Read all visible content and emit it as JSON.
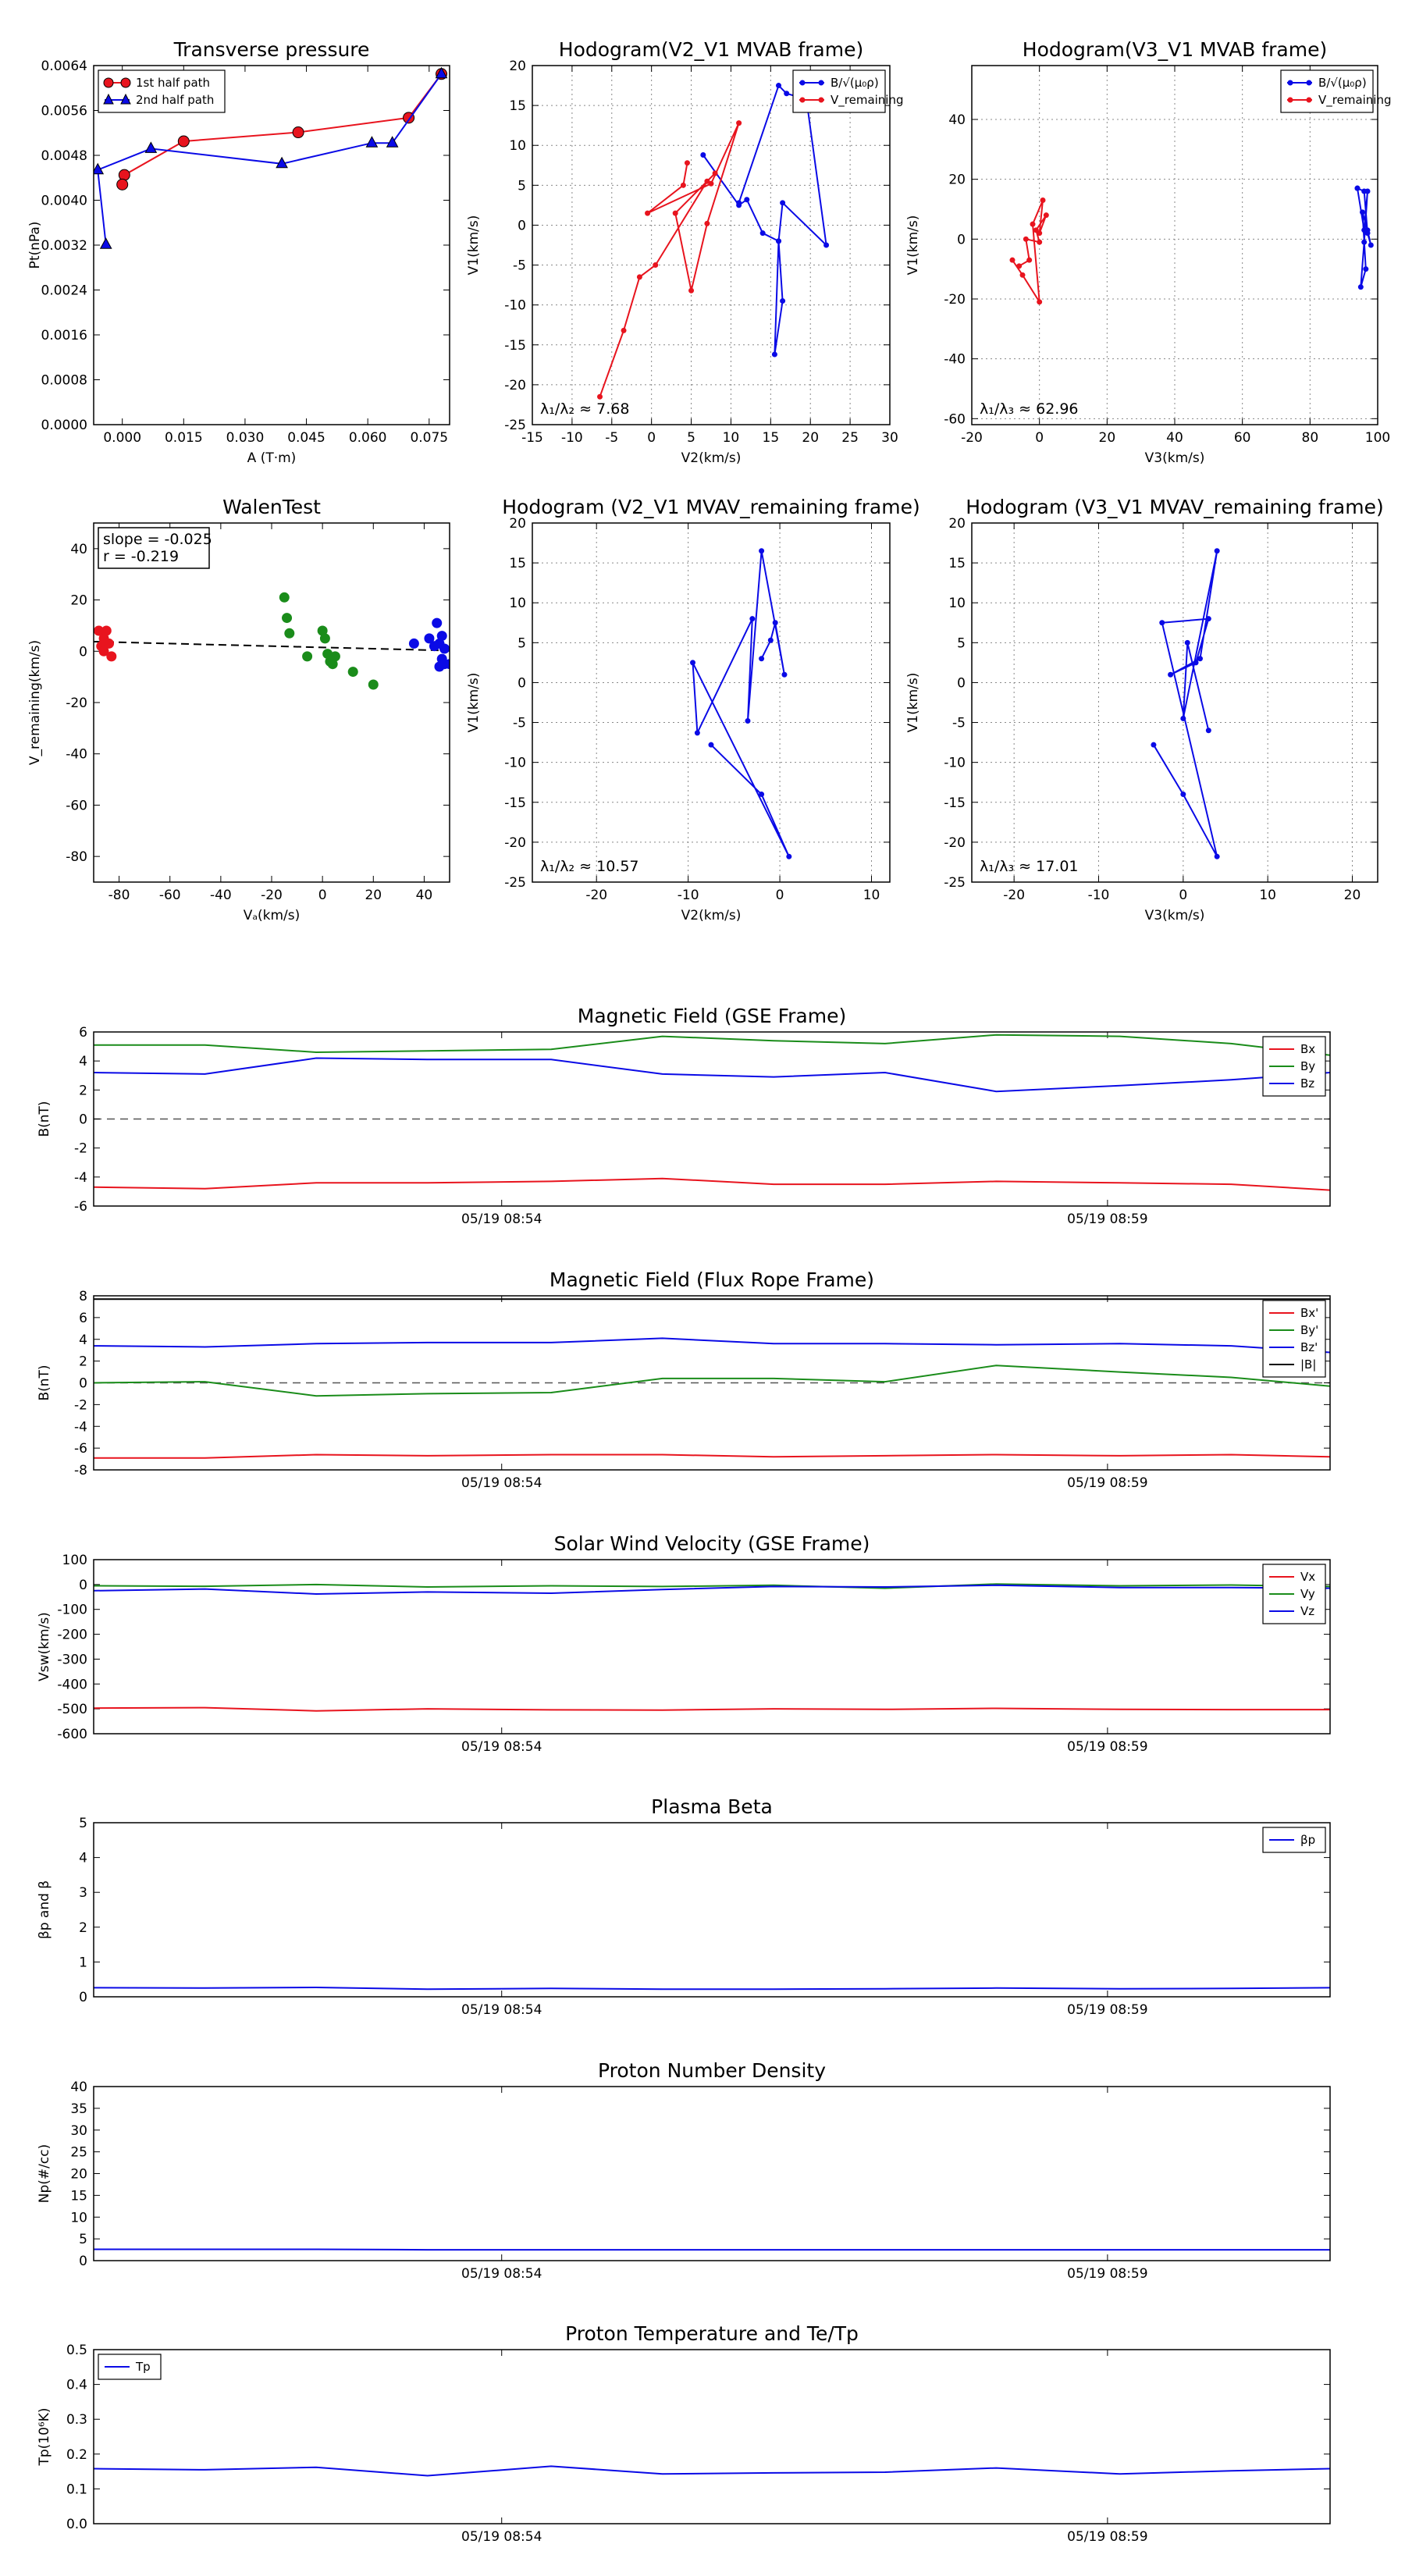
{
  "colors": {
    "red": "#e8141e",
    "green": "#1a8c1a",
    "blue": "#0a0ae6",
    "black": "#000000",
    "grid": "#888888"
  },
  "chart_data": [
    {
      "id": "tp",
      "type": "line",
      "title": "Transverse pressure",
      "xlabel": "A (T·m)",
      "ylabel": "Pt(nPa)",
      "xlim": [
        -0.007,
        0.08
      ],
      "ylim": [
        0,
        0.0064
      ],
      "xticks": [
        0.0,
        0.015,
        0.03,
        0.045,
        0.06,
        0.075
      ],
      "xtick_labels": [
        "0.000",
        "0.015",
        "0.030",
        "0.045",
        "0.060",
        "0.075"
      ],
      "yticks": [
        0,
        0.0008,
        0.0016,
        0.0024,
        0.0032,
        0.004,
        0.0048,
        0.0056,
        0.0064
      ],
      "ytick_labels": [
        "0.0000",
        "0.0008",
        "0.0016",
        "0.0024",
        "0.0032",
        "0.0040",
        "0.0048",
        "0.0056",
        "0.0064"
      ],
      "grid": false,
      "legend": "upper-left",
      "series": [
        {
          "name": "1st half path",
          "color": "red",
          "marker": "circle",
          "x": [
            0.078,
            0.07,
            0.043,
            0.015,
            0.0005,
            0.0
          ],
          "y": [
            0.00625,
            0.00547,
            0.00521,
            0.00505,
            0.00445,
            0.00428
          ]
        },
        {
          "name": "2nd half path",
          "color": "blue",
          "marker": "triangle",
          "x": [
            0.078,
            0.066,
            0.061,
            0.039,
            0.007,
            -0.006,
            -0.004
          ],
          "y": [
            0.00625,
            0.00502,
            0.00502,
            0.00465,
            0.00492,
            0.00454,
            0.00321
          ]
        }
      ]
    },
    {
      "id": "hodo_v2v1_mvab",
      "type": "line",
      "title": "Hodogram(V2_V1 MVAB frame)",
      "xlabel": "V2(km/s)",
      "ylabel": "V1(km/s)",
      "xlim": [
        -15,
        30
      ],
      "ylim": [
        -25,
        20
      ],
      "xticks": [
        -15,
        -10,
        -5,
        0,
        5,
        10,
        15,
        20,
        25,
        30
      ],
      "yticks": [
        -25,
        -20,
        -15,
        -10,
        -5,
        0,
        5,
        10,
        15,
        20
      ],
      "grid": true,
      "legend": "upper-right",
      "annotation": "λ₁/λ₂ ≈ 7.68",
      "series": [
        {
          "name": "B/√(μ₀ρ)",
          "color": "blue",
          "marker": "dot",
          "x": [
            6.5,
            11,
            12,
            14,
            16,
            16.5,
            15.5,
            16,
            16.5,
            22,
            19.5,
            17,
            16,
            11
          ],
          "y": [
            8.8,
            2.5,
            3.2,
            -1,
            -2,
            -9.5,
            -16.2,
            -2,
            2.8,
            -2.5,
            15.8,
            16.5,
            17.5,
            2.8
          ]
        },
        {
          "name": "V_remaining",
          "color": "red",
          "marker": "dot",
          "x": [
            -6.5,
            -3.5,
            -1.5,
            0.5,
            7,
            8,
            3,
            5,
            7,
            11,
            7.5,
            -0.5,
            4,
            4.5
          ],
          "y": [
            -21.5,
            -13.2,
            -6.5,
            -5,
            5.5,
            6.5,
            1.5,
            -8.2,
            0.2,
            12.8,
            5.2,
            1.5,
            5,
            7.8
          ]
        }
      ]
    },
    {
      "id": "hodo_v3v1_mvab",
      "type": "line",
      "title": "Hodogram(V3_V1 MVAB frame)",
      "xlabel": "V3(km/s)",
      "ylabel": "V1(km/s)",
      "xlim": [
        -20,
        100
      ],
      "ylim": [
        -62,
        58
      ],
      "xticks": [
        -20,
        0,
        20,
        40,
        60,
        80,
        100
      ],
      "yticks": [
        -60,
        -40,
        -20,
        0,
        20,
        40
      ],
      "grid": true,
      "legend": "upper-right",
      "annotation": "λ₁/λ₃ ≈ 62.96",
      "series": [
        {
          "name": "B/√(μ₀ρ)",
          "color": "blue",
          "marker": "dot",
          "x": [
            94,
            96,
            97,
            98,
            97,
            95.5,
            96.5,
            95,
            96,
            97,
            96,
            94
          ],
          "y": [
            17,
            16,
            2,
            -2,
            3,
            9,
            -10,
            -16,
            -1,
            16,
            3,
            17
          ]
        },
        {
          "name": "V_remaining",
          "color": "red",
          "marker": "dot",
          "x": [
            -8,
            -5,
            0,
            -2,
            1,
            0,
            2,
            -1,
            0,
            -4,
            -3,
            -6
          ],
          "y": [
            -7,
            -12,
            -21,
            5,
            13,
            2,
            8,
            3,
            -1,
            0,
            -7,
            -9
          ]
        }
      ]
    },
    {
      "id": "walen",
      "type": "scatter",
      "title": "WalenTest",
      "xlabel": "Vₐ(km/s)",
      "ylabel": "V_remaining(km/s)",
      "xlim": [
        -90,
        50
      ],
      "ylim": [
        -90,
        50
      ],
      "xticks": [
        -80,
        -60,
        -40,
        -20,
        0,
        20,
        40
      ],
      "yticks": [
        -80,
        -60,
        -40,
        -20,
        0,
        20,
        40
      ],
      "grid": false,
      "annotation": [
        "slope = -0.025",
        "r = -0.219"
      ],
      "fit": {
        "slope": -0.025,
        "intercept": 1.5,
        "style": "dashed"
      },
      "series": [
        {
          "color": "red",
          "x": [
            -88,
            -86,
            -87,
            -84,
            -85,
            -83,
            -86
          ],
          "y": [
            8,
            5,
            2,
            3,
            8,
            -2,
            0
          ]
        },
        {
          "color": "green",
          "x": [
            -15,
            -14,
            -13,
            -6,
            0,
            1,
            2,
            3,
            5,
            4,
            12,
            20
          ],
          "y": [
            21,
            13,
            7,
            -2,
            8,
            5,
            -1,
            -4,
            -2,
            -5,
            -8,
            -13
          ]
        },
        {
          "color": "blue",
          "x": [
            36,
            42,
            44,
            45,
            46,
            47,
            48,
            46,
            47,
            48,
            50,
            52
          ],
          "y": [
            3,
            5,
            2,
            11,
            3,
            6,
            1,
            -6,
            -3,
            -5,
            -5,
            -2
          ]
        }
      ]
    },
    {
      "id": "hodo_v2v1_mvav",
      "type": "line",
      "title": "Hodogram (V2_V1 MVAV_remaining frame)",
      "xlabel": "V2(km/s)",
      "ylabel": "V1(km/s)",
      "xlim": [
        -27,
        12
      ],
      "ylim": [
        -25,
        20
      ],
      "xticks": [
        -20,
        -10,
        0,
        10
      ],
      "yticks": [
        -25,
        -20,
        -15,
        -10,
        -5,
        0,
        5,
        10,
        15,
        20
      ],
      "grid": true,
      "annotation": "λ₁/λ₂ ≈ 10.57",
      "series": [
        {
          "color": "blue",
          "marker": "dot",
          "x": [
            -7.5,
            -2,
            1,
            -9.5,
            -9,
            -3,
            -3.5,
            -2,
            0.5,
            -0.5,
            -1,
            -2
          ],
          "y": [
            -7.8,
            -14,
            -21.8,
            2.5,
            -6.3,
            8,
            -4.8,
            16.5,
            1,
            7.5,
            5.3,
            3
          ]
        }
      ]
    },
    {
      "id": "hodo_v3v1_mvav",
      "type": "line",
      "title": "Hodogram (V3_V1 MVAV_remaining frame)",
      "xlabel": "V3(km/s)",
      "ylabel": "V1(km/s)",
      "xlim": [
        -25,
        23
      ],
      "ylim": [
        -25,
        20
      ],
      "xticks": [
        -20,
        -10,
        0,
        10,
        20
      ],
      "yticks": [
        -25,
        -20,
        -15,
        -10,
        -5,
        0,
        5,
        10,
        15,
        20
      ],
      "grid": true,
      "annotation": "λ₁/λ₃ ≈ 17.01",
      "series": [
        {
          "color": "blue",
          "marker": "dot",
          "x": [
            -3.5,
            0,
            4,
            -2.5,
            3,
            1.5,
            -1.5,
            2,
            4,
            0,
            0.5,
            3
          ],
          "y": [
            -7.8,
            -14,
            -21.8,
            7.5,
            8,
            2.5,
            1,
            3,
            16.5,
            -4.5,
            5,
            -6
          ]
        }
      ]
    },
    {
      "id": "bgse",
      "type": "line",
      "title": "Magnetic Field (GSE Frame)",
      "ylabel": "B(nT)",
      "xlim": [
        0,
        10
      ],
      "ylim": [
        -6,
        6
      ],
      "yticks": [
        -6,
        -4,
        -2,
        0,
        2,
        4,
        6
      ],
      "xticks": [
        3.3,
        8.2
      ],
      "xtick_labels": [
        "05/19 08:54",
        "05/19 08:59"
      ],
      "zero_line": true,
      "legend": "upper-right",
      "x": [
        0,
        0.9,
        1.8,
        2.7,
        3.7,
        4.6,
        5.5,
        6.4,
        7.3,
        8.3,
        9.2,
        10
      ],
      "series": [
        {
          "name": "Bx",
          "color": "red",
          "values": [
            -4.7,
            -4.8,
            -4.4,
            -4.4,
            -4.3,
            -4.1,
            -4.5,
            -4.5,
            -4.3,
            -4.4,
            -4.5,
            -4.9
          ]
        },
        {
          "name": "By",
          "color": "green",
          "values": [
            5.1,
            5.1,
            4.6,
            4.7,
            4.8,
            5.7,
            5.4,
            5.2,
            5.8,
            5.7,
            5.2,
            4.4
          ]
        },
        {
          "name": "Bz",
          "color": "blue",
          "values": [
            3.2,
            3.1,
            4.2,
            4.1,
            4.1,
            3.1,
            2.9,
            3.2,
            1.9,
            2.3,
            2.7,
            3.2
          ]
        }
      ]
    },
    {
      "id": "bfr",
      "type": "line",
      "title": "Magnetic Field (Flux Rope Frame)",
      "ylabel": "B(nT)",
      "xlim": [
        0,
        10
      ],
      "ylim": [
        -8,
        8
      ],
      "yticks": [
        -8,
        -6,
        -4,
        -2,
        0,
        2,
        4,
        6,
        8
      ],
      "xticks": [
        3.3,
        8.2
      ],
      "xtick_labels": [
        "05/19 08:54",
        "05/19 08:59"
      ],
      "zero_line": true,
      "legend": "upper-right",
      "x": [
        0,
        0.9,
        1.8,
        2.7,
        3.7,
        4.6,
        5.5,
        6.4,
        7.3,
        8.3,
        9.2,
        10
      ],
      "series": [
        {
          "name": "Bx'",
          "color": "red",
          "values": [
            -6.9,
            -6.9,
            -6.6,
            -6.7,
            -6.6,
            -6.6,
            -6.8,
            -6.7,
            -6.6,
            -6.7,
            -6.6,
            -6.8
          ]
        },
        {
          "name": "By'",
          "color": "green",
          "values": [
            0.0,
            0.1,
            -1.2,
            -1.0,
            -0.9,
            0.4,
            0.4,
            0.1,
            1.6,
            1.0,
            0.5,
            -0.3
          ]
        },
        {
          "name": "Bz'",
          "color": "blue",
          "values": [
            3.4,
            3.3,
            3.6,
            3.7,
            3.7,
            4.1,
            3.6,
            3.6,
            3.5,
            3.6,
            3.4,
            2.8
          ]
        },
        {
          "name": "|B|",
          "color": "black",
          "values": [
            7.7,
            7.7,
            7.7,
            7.7,
            7.7,
            7.7,
            7.7,
            7.7,
            7.7,
            7.7,
            7.7,
            7.7
          ]
        }
      ]
    },
    {
      "id": "vsw",
      "type": "line",
      "title": "Solar Wind Velocity (GSE Frame)",
      "ylabel": "Vsw(km/s)",
      "xlim": [
        0,
        10
      ],
      "ylim": [
        -600,
        100
      ],
      "yticks": [
        -600,
        -500,
        -400,
        -300,
        -200,
        -100,
        0,
        100
      ],
      "xticks": [
        3.3,
        8.2
      ],
      "xtick_labels": [
        "05/19 08:54",
        "05/19 08:59"
      ],
      "legend": "upper-right",
      "x": [
        0,
        0.9,
        1.8,
        2.7,
        3.7,
        4.6,
        5.5,
        6.4,
        7.3,
        8.3,
        9.2,
        10
      ],
      "series": [
        {
          "name": "Vx",
          "color": "red",
          "values": [
            -497,
            -495,
            -508,
            -500,
            -504,
            -505,
            -500,
            -502,
            -498,
            -502,
            -503,
            -503
          ]
        },
        {
          "name": "Vy",
          "color": "green",
          "values": [
            -5,
            -7,
            0,
            -10,
            -5,
            -8,
            -3,
            -15,
            2,
            -5,
            -2,
            -8
          ]
        },
        {
          "name": "Vz",
          "color": "blue",
          "values": [
            -25,
            -18,
            -38,
            -30,
            -35,
            -20,
            -8,
            -10,
            -3,
            -12,
            -12,
            -15
          ]
        }
      ]
    },
    {
      "id": "beta",
      "type": "line",
      "title": "Plasma Beta",
      "ylabel": "βp and β",
      "xlim": [
        0,
        10
      ],
      "ylim": [
        0,
        5
      ],
      "yticks": [
        0,
        1,
        2,
        3,
        4,
        5
      ],
      "xticks": [
        3.3,
        8.2
      ],
      "xtick_labels": [
        "05/19 08:54",
        "05/19 08:59"
      ],
      "legend": "upper-right",
      "x": [
        0,
        0.9,
        1.8,
        2.7,
        3.7,
        4.6,
        5.5,
        6.4,
        7.3,
        8.3,
        9.2,
        10
      ],
      "series": [
        {
          "name": "βp",
          "color": "blue",
          "values": [
            0.26,
            0.25,
            0.27,
            0.22,
            0.24,
            0.22,
            0.22,
            0.23,
            0.25,
            0.23,
            0.24,
            0.26
          ]
        }
      ]
    },
    {
      "id": "np",
      "type": "line",
      "title": "Proton Number Density",
      "ylabel": "Np(#/cc)",
      "xlim": [
        0,
        10
      ],
      "ylim": [
        0,
        40
      ],
      "yticks": [
        0,
        5,
        10,
        15,
        20,
        25,
        30,
        35,
        40
      ],
      "xticks": [
        3.3,
        8.2
      ],
      "xtick_labels": [
        "05/19 08:54",
        "05/19 08:59"
      ],
      "x": [
        0,
        0.9,
        1.8,
        2.7,
        3.7,
        4.6,
        5.5,
        6.4,
        7.3,
        8.3,
        9.2,
        10
      ],
      "series": [
        {
          "color": "blue",
          "values": [
            2.6,
            2.6,
            2.6,
            2.5,
            2.5,
            2.5,
            2.5,
            2.5,
            2.5,
            2.5,
            2.5,
            2.5
          ]
        }
      ]
    },
    {
      "id": "tp_temp",
      "type": "line",
      "title": "Proton Temperature and Te/Tp",
      "ylabel": "Tp(10⁶K)",
      "xlim": [
        0,
        10
      ],
      "ylim": [
        0,
        0.5
      ],
      "yticks": [
        0,
        0.1,
        0.2,
        0.3,
        0.4,
        0.5
      ],
      "ytick_labels": [
        "0.0",
        "0.1",
        "0.2",
        "0.3",
        "0.4",
        "0.5"
      ],
      "xticks": [
        3.3,
        8.2
      ],
      "xtick_labels": [
        "05/19 08:54",
        "05/19 08:59"
      ],
      "legend": "upper-left",
      "x": [
        0,
        0.9,
        1.8,
        2.7,
        3.7,
        4.6,
        5.5,
        6.4,
        7.3,
        8.3,
        9.2,
        10
      ],
      "series": [
        {
          "name": "Tp",
          "color": "blue",
          "values": [
            0.158,
            0.155,
            0.162,
            0.138,
            0.165,
            0.143,
            0.146,
            0.148,
            0.16,
            0.143,
            0.152,
            0.158
          ]
        }
      ]
    }
  ]
}
